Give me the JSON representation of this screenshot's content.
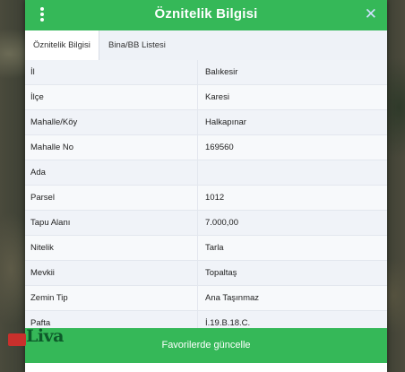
{
  "header": {
    "title": "Öznitelik Bilgisi",
    "close": "✕"
  },
  "tabs": [
    {
      "label": "Öznitelik Bilgisi",
      "active": true
    },
    {
      "label": "Bina/BB Listesi",
      "active": false
    }
  ],
  "rows": [
    {
      "key": "İl",
      "value": "Balıkesir"
    },
    {
      "key": "İlçe",
      "value": "Karesi"
    },
    {
      "key": "Mahalle/Köy",
      "value": "Halkapınar"
    },
    {
      "key": "Mahalle No",
      "value": "169560"
    },
    {
      "key": "Ada",
      "value": ""
    },
    {
      "key": "Parsel",
      "value": "1012"
    },
    {
      "key": "Tapu Alanı",
      "value": "7.000,00"
    },
    {
      "key": "Nitelik",
      "value": "Tarla"
    },
    {
      "key": "Mevkii",
      "value": "Topaltaş"
    },
    {
      "key": "Zemin Tip",
      "value": "Ana Taşınmaz"
    },
    {
      "key": "Pafta",
      "value": "İ.19.B.18.C."
    }
  ],
  "footer": {
    "button_label": "Favorilerde güncelle"
  },
  "logo": {
    "text": "Liva"
  },
  "colors": {
    "accent": "#35b858"
  }
}
